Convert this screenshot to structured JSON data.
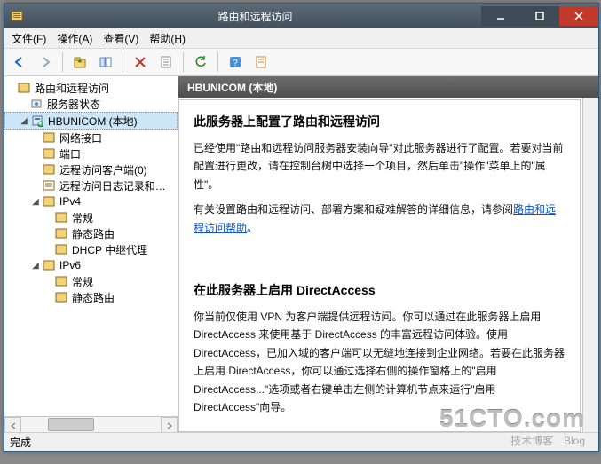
{
  "window": {
    "title": "路由和远程访问"
  },
  "menubar": {
    "file": "文件(F)",
    "action": "操作(A)",
    "view": "查看(V)",
    "help": "帮助(H)"
  },
  "tree": {
    "root": "路由和远程访问",
    "serverStatus": "服务器状态",
    "serverNode": "HBUNICOM (本地)",
    "ifc": "网络接口",
    "ports": "端口",
    "clients": "远程访问客户端(0)",
    "logs": "远程访问日志记录和策略",
    "ipv4": "IPv4",
    "ipv4_general": "常规",
    "ipv4_static": "静态路由",
    "ipv4_dhcp": "DHCP 中继代理",
    "ipv6": "IPv6",
    "ipv6_general": "常规",
    "ipv6_static": "静态路由"
  },
  "content": {
    "header": "HBUNICOM (本地)",
    "s1_title": "此服务器上配置了路由和远程访问",
    "s1_p1": "已经使用\"路由和远程访问服务器安装向导\"对此服务器进行了配置。若要对当前配置进行更改，请在控制台树中选择一个项目，然后单击\"操作\"菜单上的\"属性\"。",
    "s1_p2a": "有关设置路由和远程访问、部署方案和疑难解答的详细信息，请参阅",
    "s1_link": "路由和远程访问帮助",
    "s1_p2b": "。",
    "s2_title": "在此服务器上启用 DirectAccess",
    "s2_p1": "你当前仅使用 VPN 为客户端提供远程访问。你可以通过在此服务器上启用 DirectAccess 来使用基于 DirectAccess 的丰富远程访问体验。使用 DirectAccess，已加入域的客户端可以无缝地连接到企业网络。若要在此服务器上启用 DirectAccess，你可以通过选择右侧的操作窗格上的\"启用 DirectAccess...\"选项或者右键单击左侧的计算机节点来运行\"启用 DirectAccess\"向导。"
  },
  "status": {
    "text": "完成"
  },
  "watermark": {
    "big": "51CTO.com",
    "small": "技术博客　Blog"
  }
}
